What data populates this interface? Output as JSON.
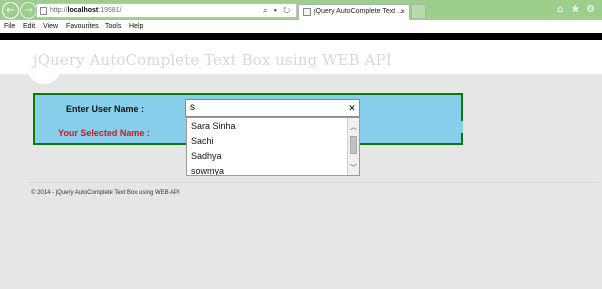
{
  "browser": {
    "url_prefix": "http://",
    "url_host": "localhost",
    "url_rest": ":19581/",
    "address_actions": "⌕ ▾ ↻",
    "tab_title": "jQuery AutoComplete Text ...",
    "tab_close": "×",
    "icons": {
      "back": "arrow-left-icon",
      "forward": "arrow-right-icon",
      "home": "home-icon",
      "favorites": "star-icon",
      "settings": "gear-icon"
    }
  },
  "menu": [
    "File",
    "Edit",
    "View",
    "Favourites",
    "Tools",
    "Help"
  ],
  "page": {
    "title": "jQuery AutoComplete Text Box using WEB API",
    "user_label": "Enter User Name :",
    "selected_label": "Your Selected Name :",
    "input_value": "s",
    "suggestions": [
      "Sara Sinha",
      "Sachi",
      "Sadhya",
      "sowmya"
    ],
    "footer": "© 2014 - jQuery AutoComplete Text Box using WEB API"
  },
  "colors": {
    "chrome": "#9ccf8d",
    "form_bg": "#87ceeb",
    "form_border": "#0b7a0b",
    "selected_label": "#d3171b"
  }
}
